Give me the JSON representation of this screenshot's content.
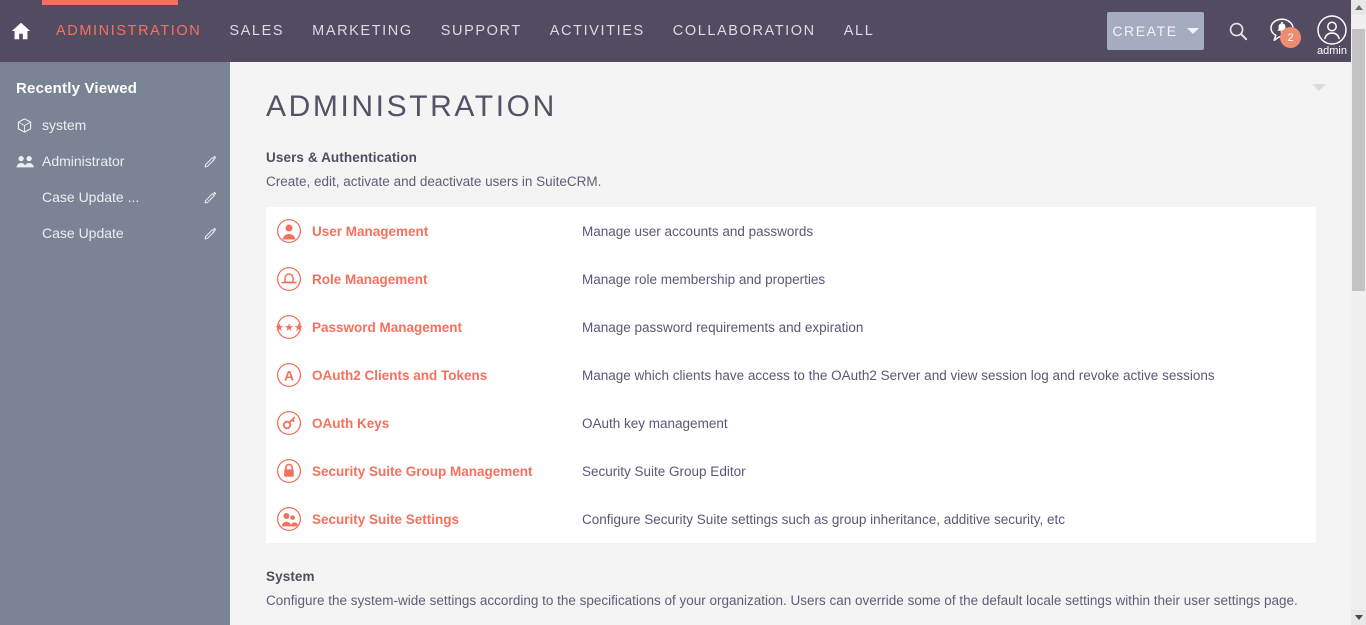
{
  "topnav": {
    "home_icon": "home-icon",
    "items": [
      {
        "label": "ADMINISTRATION",
        "active": true
      },
      {
        "label": "SALES",
        "active": false
      },
      {
        "label": "MARKETING",
        "active": false
      },
      {
        "label": "SUPPORT",
        "active": false
      },
      {
        "label": "ACTIVITIES",
        "active": false
      },
      {
        "label": "COLLABORATION",
        "active": false
      },
      {
        "label": "ALL",
        "active": false
      }
    ],
    "create_label": "CREATE",
    "search_icon": "search-icon",
    "notification_icon": "notification-bell-icon",
    "notification_count": "2",
    "user_icon": "user-avatar-icon",
    "user_name": "admin",
    "accent_color": "#f4715e",
    "background_color": "#534b62"
  },
  "sidebar": {
    "title": "Recently Viewed",
    "collapse_icon": "collapse-left-icon",
    "background_color": "#7b8494",
    "items": [
      {
        "label": "system",
        "icon": "cube-icon",
        "has_edit": false
      },
      {
        "label": "Administrator",
        "icon": "people-icon",
        "has_edit": true
      },
      {
        "label": "Case Update ...",
        "icon": "",
        "has_edit": true
      },
      {
        "label": "Case Update",
        "icon": "",
        "has_edit": true
      }
    ],
    "edit_icon": "pencil-icon"
  },
  "main": {
    "page_title": "ADMINISTRATION",
    "header_caret_icon": "chevron-down-icon",
    "sections": [
      {
        "title": "Users & Authentication",
        "description": "Create, edit, activate and deactivate users in SuiteCRM.",
        "rows": [
          {
            "icon": "user-circle-icon",
            "link": "User Management",
            "desc": "Manage user accounts and passwords"
          },
          {
            "icon": "role-hat-icon",
            "link": "Role Management",
            "desc": "Manage role membership and properties"
          },
          {
            "icon": "password-asterisks-icon",
            "link": "Password Management",
            "desc": "Manage password requirements and expiration"
          },
          {
            "icon": "oauth2-a-icon",
            "link": "OAuth2 Clients and Tokens",
            "desc": "Manage which clients have access to the OAuth2 Server and view session log and revoke active sessions"
          },
          {
            "icon": "key-icon",
            "link": "OAuth Keys",
            "desc": "OAuth key management"
          },
          {
            "icon": "padlock-icon",
            "link": "Security Suite Group Management",
            "desc": "Security Suite Group Editor"
          },
          {
            "icon": "people-circle-icon",
            "link": "Security Suite Settings",
            "desc": "Configure Security Suite settings such as group inheritance, additive security, etc"
          }
        ]
      },
      {
        "title": "System",
        "description": "Configure the system-wide settings according to the specifications of your organization. Users can override some of the default locale settings within their user settings page.",
        "rows": []
      }
    ],
    "link_color": "#f4715e",
    "text_color": "#5f5672"
  }
}
